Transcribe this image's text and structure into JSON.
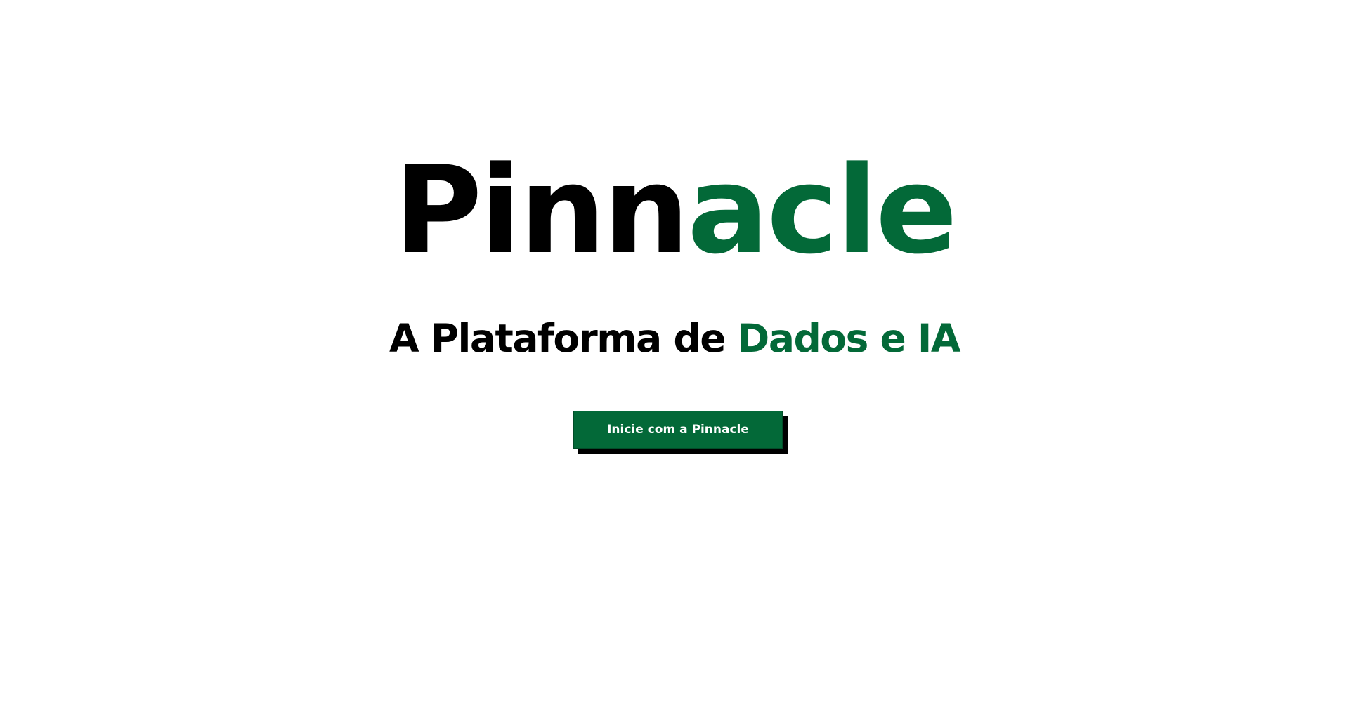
{
  "hero": {
    "title_dark": "Pinn",
    "title_green": "acle",
    "tagline_dark": "A Plataforma de ",
    "tagline_green": "Dados e IA",
    "cta_label": "Inicie com a Pinnacle"
  },
  "colors": {
    "brand_green": "#036938",
    "text_dark": "#000000",
    "background": "#ffffff",
    "button_shadow": "#000000"
  }
}
